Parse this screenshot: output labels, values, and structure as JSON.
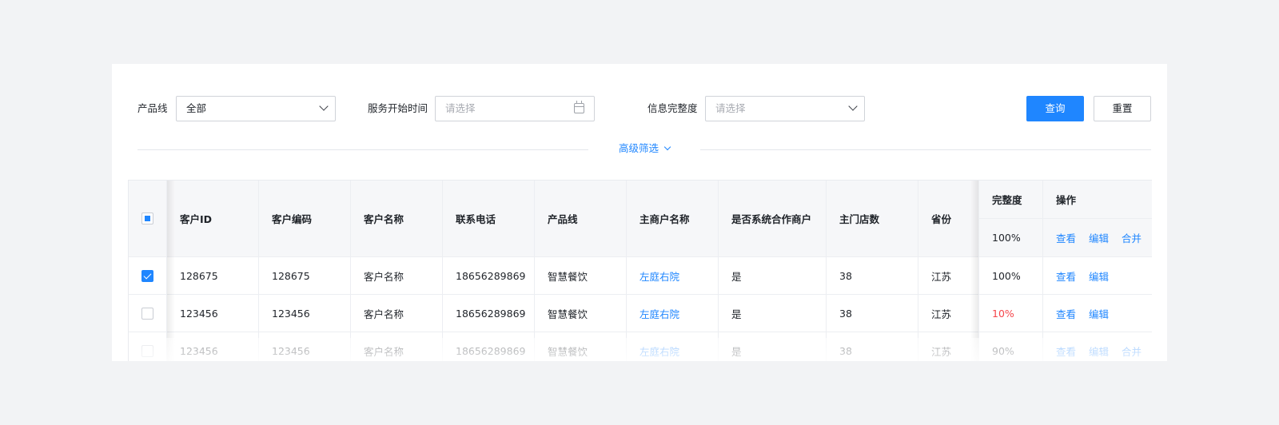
{
  "filters": {
    "product_line": {
      "label": "产品线",
      "value": "全部"
    },
    "service_start": {
      "label": "服务开始时间",
      "placeholder": "请选择"
    },
    "info_completeness": {
      "label": "信息完整度",
      "placeholder": "请选择"
    },
    "query_button": "查询",
    "reset_button": "重置",
    "advanced": "高级筛选"
  },
  "table": {
    "headers": {
      "customer_id": "客户ID",
      "customer_code": "客户编码",
      "customer_name": "客户名称",
      "phone": "联系电话",
      "product_line": "产品线",
      "merchant_name": "主商户名称",
      "is_partner": "是否系统合作商户",
      "store_count": "主门店数",
      "province": "省份",
      "completeness": "完整度",
      "operation": "操作"
    },
    "header_extra": {
      "completeness": "100%",
      "actions": [
        "查看",
        "编辑",
        "合并"
      ]
    },
    "rows": [
      {
        "checked": true,
        "customer_id": "128675",
        "customer_code": "128675",
        "customer_name": "客户名称",
        "phone": "18656289869",
        "product_line": "智慧餐饮",
        "merchant_name": "左庭右院",
        "is_partner": "是",
        "store_count": "38",
        "province": "江苏",
        "completeness": "100%",
        "completeness_color": "#1f2329",
        "actions": [
          "查看",
          "编辑"
        ]
      },
      {
        "checked": false,
        "customer_id": "123456",
        "customer_code": "123456",
        "customer_name": "客户名称",
        "phone": "18656289869",
        "product_line": "智慧餐饮",
        "merchant_name": "左庭右院",
        "is_partner": "是",
        "store_count": "38",
        "province": "江苏",
        "completeness": "10%",
        "completeness_color": "#f5464b",
        "actions": [
          "查看",
          "编辑"
        ]
      },
      {
        "checked": false,
        "customer_id": "123456",
        "customer_code": "123456",
        "customer_name": "客户名称",
        "phone": "18656289869",
        "product_line": "智慧餐饮",
        "merchant_name": "左庭右院",
        "is_partner": "是",
        "store_count": "38",
        "province": "江苏",
        "completeness": "90%",
        "completeness_color": "#1f2329",
        "actions": [
          "查看",
          "编辑",
          "合并"
        ]
      }
    ]
  },
  "colors": {
    "primary": "#1f86ff",
    "danger": "#f5464b",
    "background": "#f2f3f5"
  }
}
